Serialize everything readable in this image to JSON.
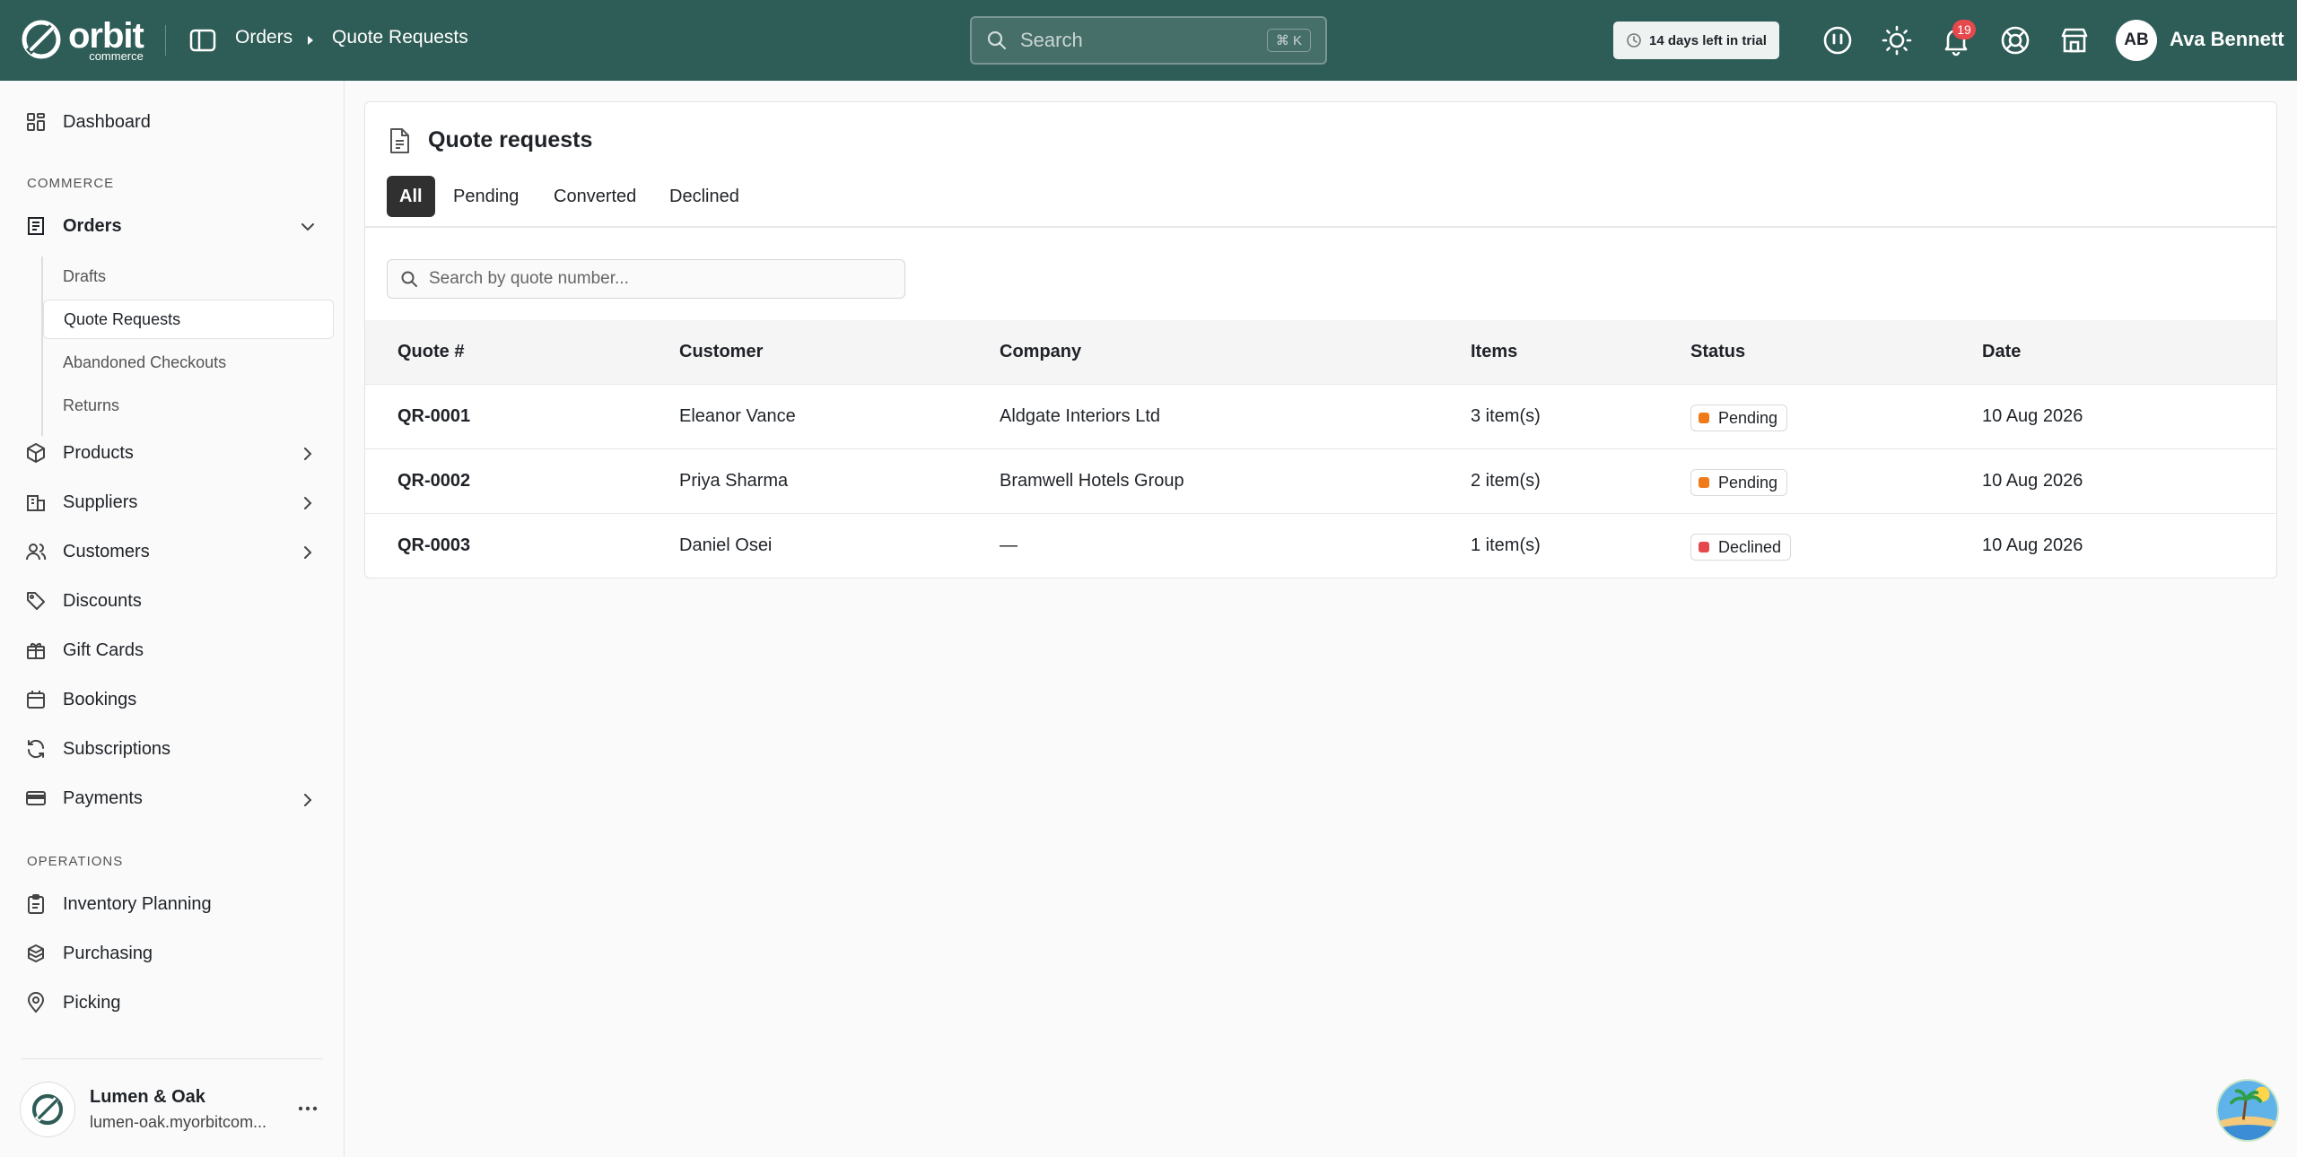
{
  "brand": {
    "word": "orbit",
    "sub": "commerce"
  },
  "breadcrumb": {
    "section": "Orders",
    "current": "Quote Requests"
  },
  "search": {
    "placeholder": "Search",
    "shortcut": "⌘ K"
  },
  "trial": {
    "label": "14 days left in trial"
  },
  "notifications": {
    "count": "19"
  },
  "user": {
    "initials": "AB",
    "name": "Ava Bennett"
  },
  "icons": [
    "panel-icon",
    "feedback-icon",
    "sun-icon",
    "bell-icon",
    "help-icon",
    "store-icon"
  ],
  "sidebar": {
    "dashboard": "Dashboard",
    "section_commerce": "COMMERCE",
    "orders": "Orders",
    "orders_sub": [
      "Drafts",
      "Quote Requests",
      "Abandoned Checkouts",
      "Returns"
    ],
    "products": "Products",
    "suppliers": "Suppliers",
    "customers": "Customers",
    "discounts": "Discounts",
    "gift_cards": "Gift Cards",
    "bookings": "Bookings",
    "subscriptions": "Subscriptions",
    "payments": "Payments",
    "section_operations": "OPERATIONS",
    "inventory_planning": "Inventory Planning",
    "purchasing": "Purchasing",
    "picking": "Picking"
  },
  "store": {
    "name": "Lumen & Oak",
    "url": "lumen-oak.myorbitcom..."
  },
  "page": {
    "title": "Quote requests",
    "tabs": [
      "All",
      "Pending",
      "Converted",
      "Declined"
    ],
    "active_tab": "All",
    "filter_placeholder": "Search by quote number..."
  },
  "table": {
    "columns": [
      "Quote #",
      "Customer",
      "Company",
      "Items",
      "Status",
      "Date"
    ],
    "rows": [
      {
        "id": "QR-0001",
        "customer": "Eleanor Vance",
        "company": "Aldgate Interiors Ltd",
        "items": "3 item(s)",
        "status": "Pending",
        "date": "10 Aug 2026"
      },
      {
        "id": "QR-0002",
        "customer": "Priya Sharma",
        "company": "Bramwell Hotels Group",
        "items": "2 item(s)",
        "status": "Pending",
        "date": "10 Aug 2026"
      },
      {
        "id": "QR-0003",
        "customer": "Daniel Osei",
        "company": "—",
        "items": "1 item(s)",
        "status": "Declined",
        "date": "10 Aug 2026"
      }
    ]
  },
  "colors": {
    "topbar": "#2e5c56",
    "pending": "#f07a1a",
    "declined": "#e5484d",
    "badge": "#e5484d"
  }
}
